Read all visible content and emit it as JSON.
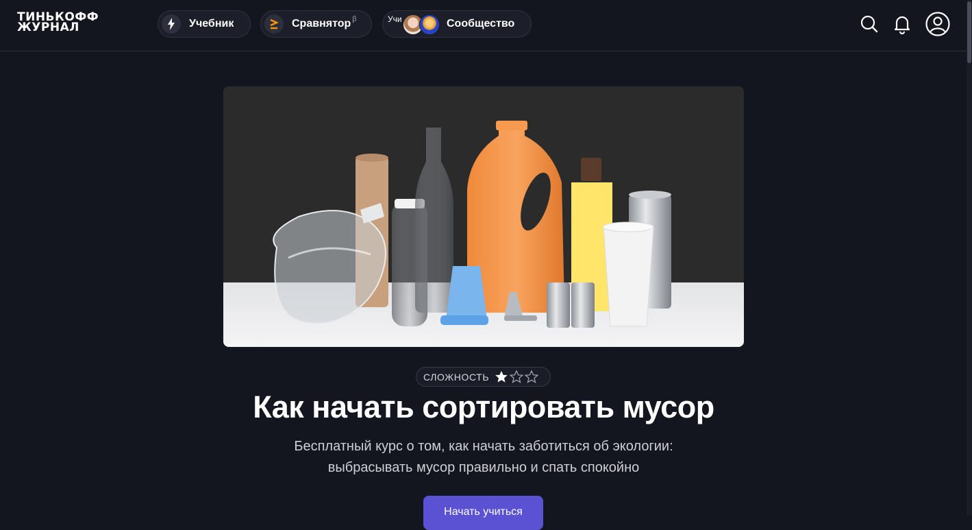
{
  "header": {
    "logo_line1": "ТИНЬКОФФ",
    "logo_line2": "ЖУРНАЛ",
    "nav": {
      "textbook": "Учебник",
      "comparator": "Сравнятор",
      "comparator_sup": "β",
      "community": "Сообщество",
      "community_cut_text": "Учи ..."
    },
    "icons": [
      "search-icon",
      "bell-icon",
      "user-icon"
    ]
  },
  "article": {
    "difficulty_label": "СЛОЖНОСТЬ",
    "difficulty_rating": 1,
    "difficulty_max": 5,
    "stars_shown": 3,
    "title": "Как начать сортировать мусор",
    "subtitle_line1": "Бесплатный курс о том, как начать заботиться об экологии:",
    "subtitle_line2": "выбрасывать мусор правильно и спать спокойно",
    "cta_label": "Начать учиться"
  },
  "colors": {
    "background": "#13151f",
    "accent": "#5a52d3",
    "comparator_icon": "#ff9500",
    "bottle_orange": "#f59a4e",
    "bottle_yellow": "#ffe66a",
    "cup_blue": "#7bb5ee"
  }
}
